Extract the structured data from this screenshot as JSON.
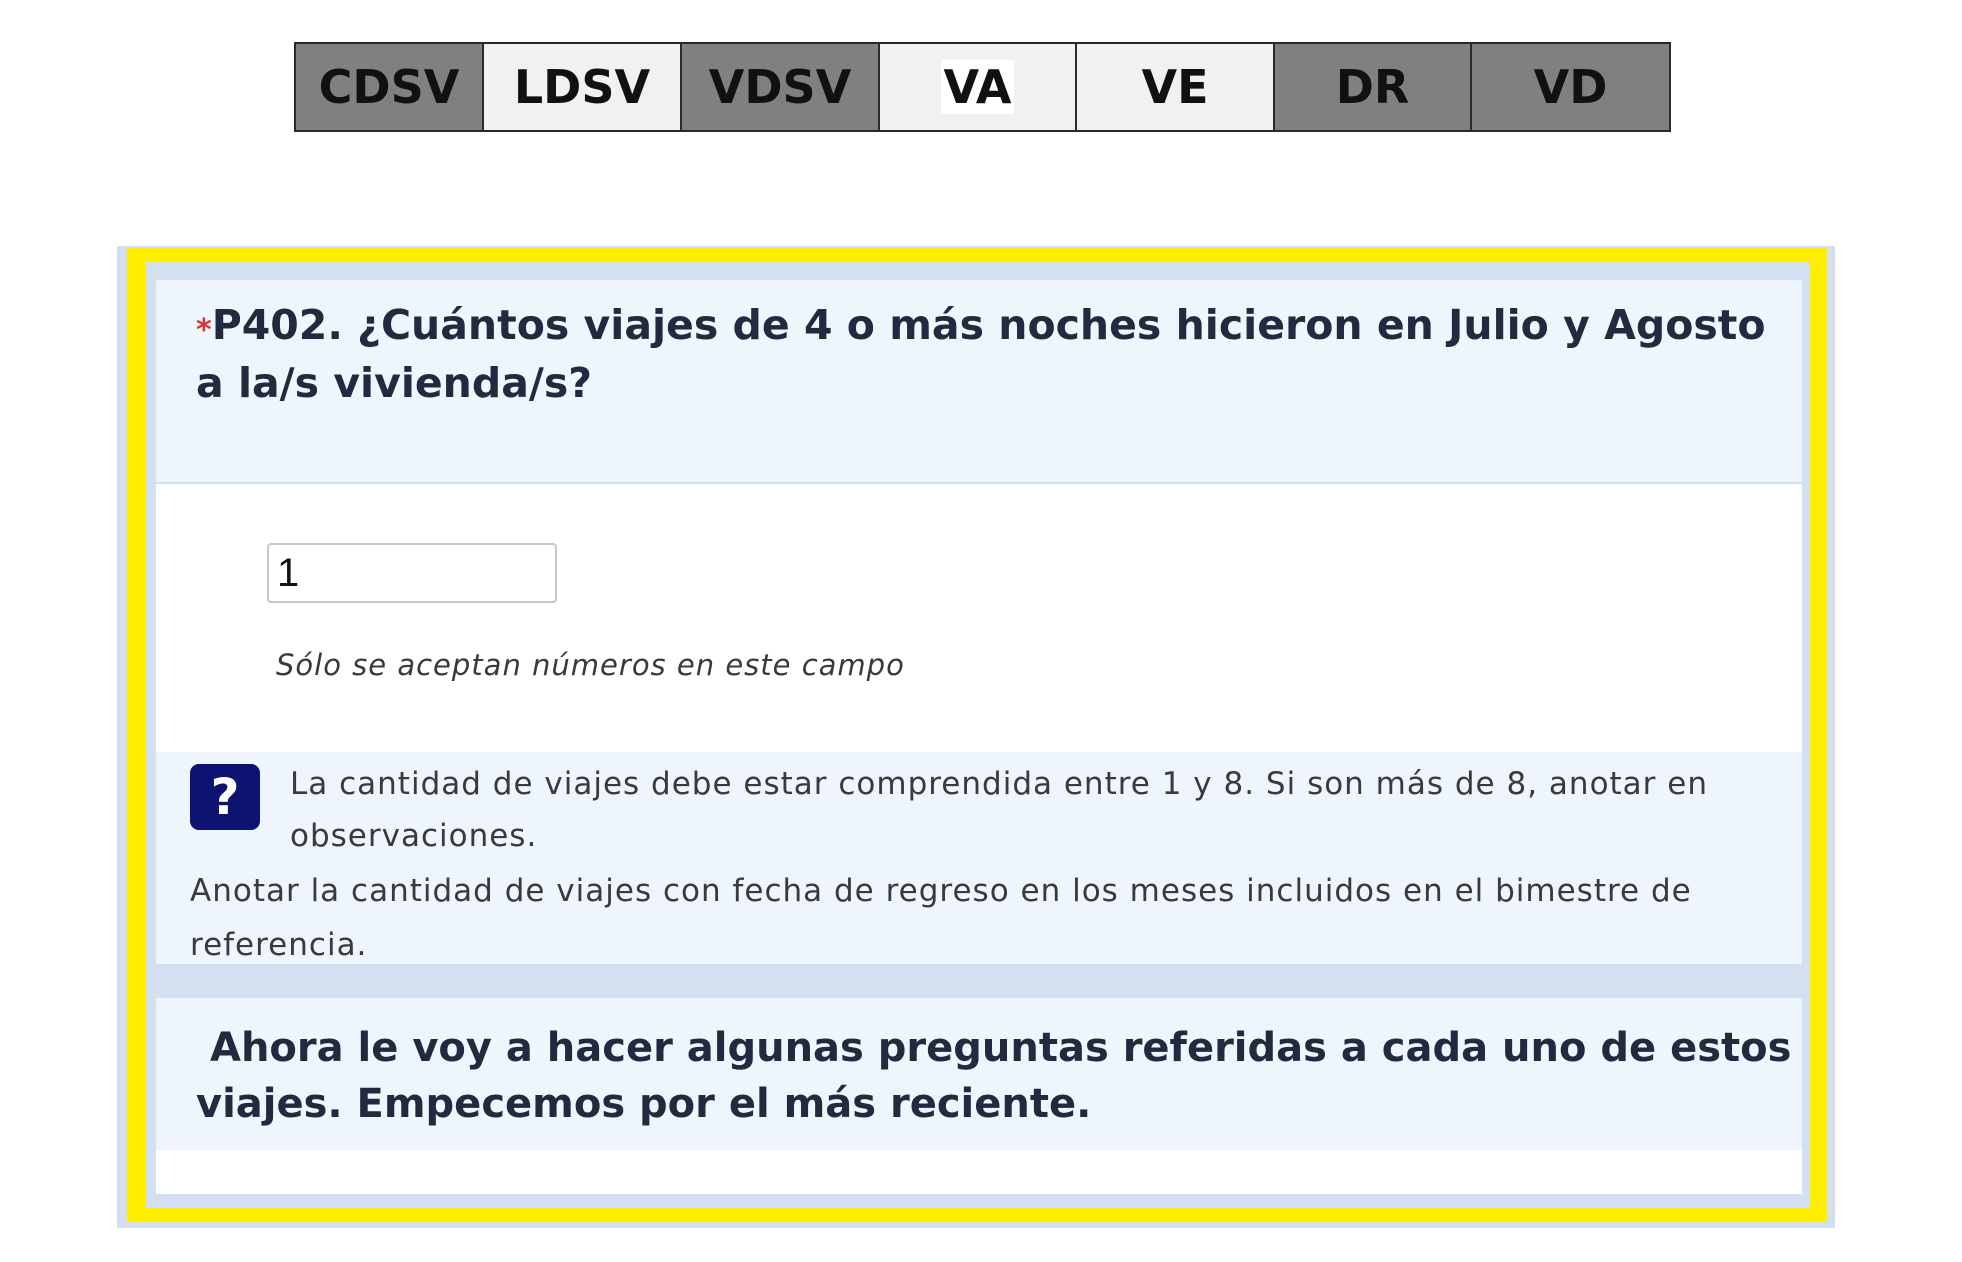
{
  "tabs": [
    {
      "label": "CDSV"
    },
    {
      "label": "LDSV"
    },
    {
      "label": "VDSV"
    },
    {
      "label": "VA"
    },
    {
      "label": "VE"
    },
    {
      "label": "DR"
    },
    {
      "label": "VD"
    }
  ],
  "question": {
    "required_marker": "*",
    "title": "P402. ¿Cuántos viajes de 4 o más noches hicieron en Julio y Agosto a la/s  vivienda/s?",
    "answer_value": "1",
    "validation_hint": "Sólo se aceptan números en este campo"
  },
  "help": {
    "icon_symbol": "?",
    "line1": "La cantidad de viajes debe estar comprendida entre 1 y 8. Si son más de 8, anotar en observaciones.",
    "line2": "Anotar la cantidad de viajes con fecha de regreso en los meses incluidos en el bimestre de referencia."
  },
  "intro": {
    "text": "Ahora le voy a hacer algunas preguntas referidas a cada uno de estos viajes. Empecemos por el más reciente."
  },
  "colors": {
    "highlight_border": "#ffee00",
    "panel_background": "#eef5fd",
    "frame_background": "#d3e0f1",
    "tab_active": "#808080",
    "tab_inactive": "#f1f1f1",
    "help_icon": "#0c1370",
    "required_marker": "#dd3333"
  }
}
